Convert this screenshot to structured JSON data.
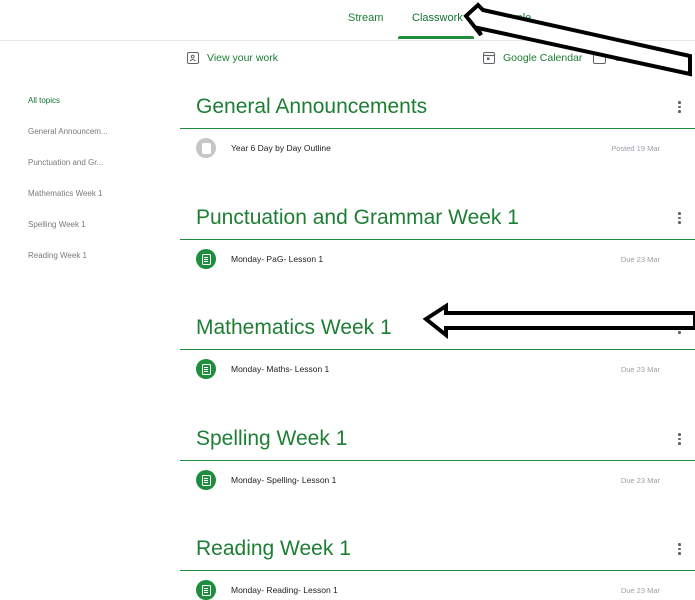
{
  "nav": {
    "tabs": [
      {
        "label": "Stream"
      },
      {
        "label": "Classwork"
      },
      {
        "label": "People"
      }
    ]
  },
  "toolbar": {
    "view_work": "View your work",
    "google_calendar": "Google Calendar",
    "class_drive": "Class"
  },
  "sidebar": {
    "items": [
      {
        "label": "All topics"
      },
      {
        "label": "General Announcem..."
      },
      {
        "label": "Punctuation and Gr..."
      },
      {
        "label": "Mathematics Week 1"
      },
      {
        "label": "Spelling Week 1"
      },
      {
        "label": "Reading Week 1"
      }
    ]
  },
  "sections": [
    {
      "title": "General Announcements",
      "item": {
        "title": "Year 6 Day by Day Outline",
        "meta": "Posted 19 Mar"
      }
    },
    {
      "title": "Punctuation and Grammar Week 1",
      "item": {
        "title": "Monday- PaG- Lesson 1",
        "meta": "Due 23 Mar"
      }
    },
    {
      "title": "Mathematics Week 1",
      "item": {
        "title": "Monday- Maths- Lesson 1",
        "meta": "Due 23 Mar"
      }
    },
    {
      "title": "Spelling Week 1",
      "item": {
        "title": "Monday- Spelling- Lesson 1",
        "meta": "Due 23 Mar"
      }
    },
    {
      "title": "Reading Week 1",
      "item": {
        "title": "Monday- Reading- Lesson 1",
        "meta": "Due 23 Mar"
      }
    }
  ],
  "colors": {
    "accent": "#1e8e3e",
    "text_green": "#1e7e34",
    "muted": "#9aa0a6"
  }
}
